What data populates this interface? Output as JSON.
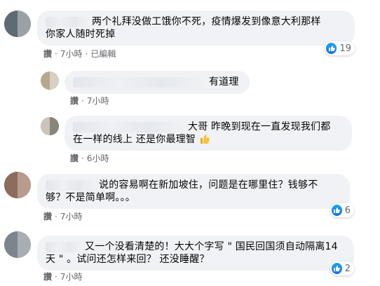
{
  "comments": [
    {
      "text_line1": "两个礼拜没做工饿你不死，疫情爆发到像意大利那样",
      "text_line2": "你家人随时死掉",
      "like_label": "讚",
      "time": "7小時",
      "edited": "已編輯",
      "reaction_count": "19",
      "avatar_colors": [
        "#5f6a72",
        "#9aa2a8"
      ]
    },
    {
      "text_line1": "有道理",
      "like_label": "讚",
      "time": "7小時",
      "avatar_colors": [
        "#b8a78f",
        "#d8d0c3"
      ]
    },
    {
      "text_line1": "大哥 昨晚到现在一直发现我们都",
      "text_line2": "在一样的线上 还是你最理智",
      "like_label": "讚",
      "time": "6小時",
      "avatar_colors": [
        "#c9c3ba",
        "#8b8478"
      ]
    },
    {
      "text_line1": "说的容易啊在新加坡住，问题是在哪里住？钱够不",
      "text_line2": "够？不是简单啊。。。",
      "like_label": "讚",
      "time": "7小時",
      "reaction_count": "6",
      "avatar_colors": [
        "#8c6c5c",
        "#b79b8c"
      ]
    },
    {
      "text_line1": "又一个没看清楚的！大大个字写 \" 国民回国须自动隔离14",
      "text_line2": "天 \" 。试问还怎样来回？ 还没睡醒？",
      "like_label": "讚",
      "time": "7小時",
      "reaction_count": "2",
      "avatar_colors": [
        "#7d848c",
        "#a9aeb4"
      ]
    }
  ],
  "colors": {
    "bubble_bg": "#f0f2f5",
    "meta_text": "#65676b",
    "like_icon_blue": "#1877f2"
  }
}
